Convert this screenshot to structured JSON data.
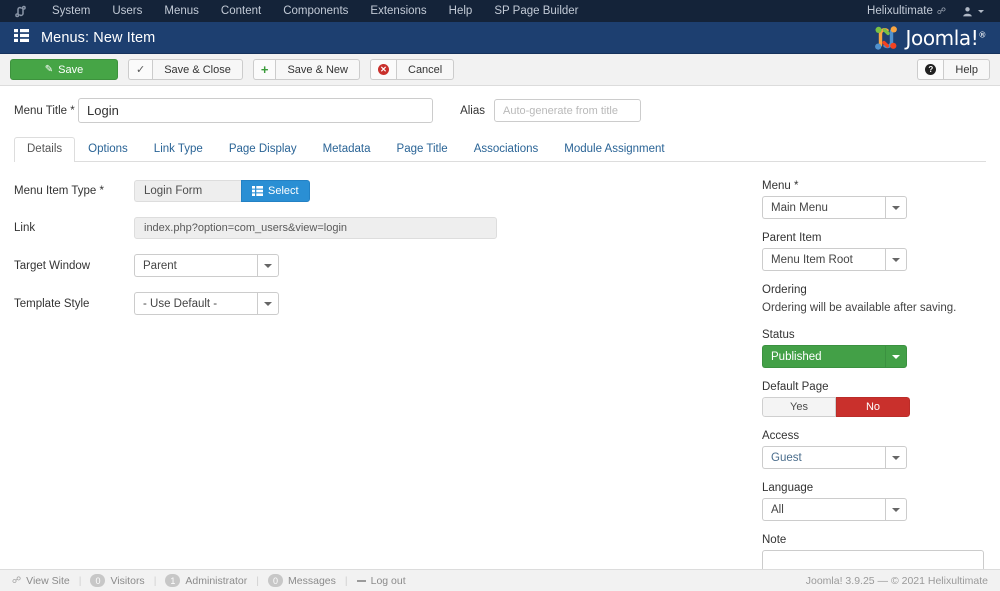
{
  "topbar": {
    "logo_icon": "joomla-mini-icon",
    "menu": [
      {
        "label": "System"
      },
      {
        "label": "Users"
      },
      {
        "label": "Menus"
      },
      {
        "label": "Content"
      },
      {
        "label": "Components"
      },
      {
        "label": "Extensions"
      },
      {
        "label": "Help"
      },
      {
        "label": "SP Page Builder"
      }
    ],
    "site_name": "Helixultimate",
    "external_link_icon": "external-link-icon",
    "user_icon": "user-icon"
  },
  "subhead": {
    "icon": "menu-list-icon",
    "title": "Menus: New Item",
    "brand": "Joomla!",
    "brand_sup": "®",
    "brand_icon": "joomla-logo-icon"
  },
  "toolbar": {
    "save_label": "Save",
    "save_icon": "pencil-square-icon",
    "save_close_label": "Save & Close",
    "save_close_icon": "check-icon",
    "save_new_label": "Save & New",
    "save_new_icon": "plus-icon",
    "cancel_label": "Cancel",
    "cancel_icon": "cancel-circle-icon",
    "help_label": "Help",
    "help_icon": "question-circle-icon",
    "save_bg": "#46a546",
    "select_bg": "#2a8fd4"
  },
  "form": {
    "menu_title_label": "Menu Title",
    "menu_title_value": "Login",
    "alias_label": "Alias",
    "alias_placeholder": "Auto-generate from title",
    "tabs": [
      {
        "label": "Details",
        "active": true
      },
      {
        "label": "Options",
        "active": false
      },
      {
        "label": "Link Type",
        "active": false
      },
      {
        "label": "Page Display",
        "active": false
      },
      {
        "label": "Metadata",
        "active": false
      },
      {
        "label": "Page Title",
        "active": false
      },
      {
        "label": "Associations",
        "active": false
      },
      {
        "label": "Module Assignment",
        "active": false
      }
    ],
    "menu_item_type_label": "Menu Item Type",
    "menu_item_type_value": "Login Form",
    "select_button_label": "Select",
    "select_button_icon": "list-icon",
    "link_label": "Link",
    "link_value": "index.php?option=com_users&view=login",
    "target_window_label": "Target Window",
    "target_window_value": "Parent",
    "template_style_label": "Template Style",
    "template_style_value": "- Use Default -"
  },
  "sidebar": {
    "menu_label": "Menu",
    "menu_value": "Main Menu",
    "parent_item_label": "Parent Item",
    "parent_item_value": "Menu Item Root",
    "ordering_label": "Ordering",
    "ordering_note": "Ordering will be available after saving.",
    "status_label": "Status",
    "status_value": "Published",
    "status_color": "#43a047",
    "default_page_label": "Default Page",
    "default_page_yes": "Yes",
    "default_page_no": "No",
    "default_page_selected": "No",
    "default_page_no_color": "#c9302c",
    "access_label": "Access",
    "access_value": "Guest",
    "language_label": "Language",
    "language_value": "All",
    "note_label": "Note",
    "note_value": ""
  },
  "footer": {
    "view_site_label": "View Site",
    "view_site_icon": "external-link-icon",
    "visitors_count": "0",
    "visitors_label": "Visitors",
    "administrator_count": "1",
    "administrator_label": "Administrator",
    "messages_count": "0",
    "messages_label": "Messages",
    "logout_label": "Log out",
    "logout_icon": "minus-icon",
    "version": "Joomla! 3.9.25  —  © 2021 Helixultimate"
  }
}
